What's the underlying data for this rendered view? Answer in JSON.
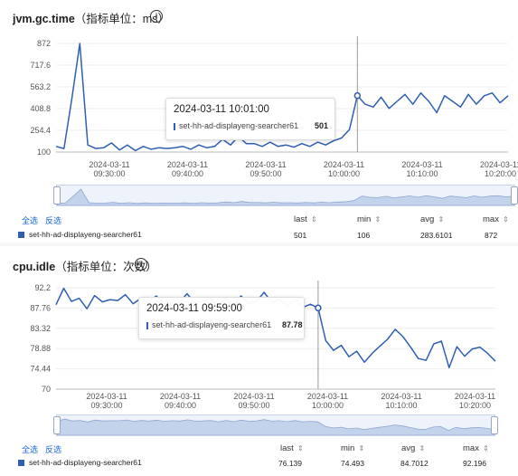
{
  "panels": [
    {
      "title": "jvm.gc.time",
      "unit": "（指标单位：ms）",
      "y_ticks": [
        "872",
        "717.6",
        "563.2",
        "408.8",
        "254.4",
        "100"
      ],
      "x_ticks": [
        [
          "2024-03-11",
          "09:30:00"
        ],
        [
          "2024-03-11",
          "09:40:00"
        ],
        [
          "2024-03-11",
          "09:50:00"
        ],
        [
          "2024-03-11",
          "10:00:00"
        ],
        [
          "2024-03-11",
          "10:10:00"
        ],
        [
          "2024-03-11",
          "10:20:00"
        ]
      ],
      "tooltip": {
        "time": "2024-03-11 10:01:00",
        "series": "set-hh-ad-displayeng-searcher61",
        "value": "501"
      },
      "actions": {
        "select_all": "全选",
        "invert": "反选"
      },
      "stats_headers": {
        "last": "last",
        "min": "min",
        "avg": "avg",
        "max": "max"
      },
      "legend": {
        "name": "set-hh-ad-displayeng-searcher61",
        "last": "501",
        "min": "106",
        "avg": "283.6101",
        "max": "872"
      }
    },
    {
      "title": "cpu.idle",
      "unit": "（指标单位：次数）",
      "y_ticks": [
        "92.2",
        "87.76",
        "83.32",
        "78.88",
        "74.44",
        "70"
      ],
      "x_ticks": [
        [
          "2024-03-11",
          "09:30:00"
        ],
        [
          "2024-03-11",
          "09:40:00"
        ],
        [
          "2024-03-11",
          "09:50:00"
        ],
        [
          "2024-03-11",
          "10:00:00"
        ],
        [
          "2024-03-11",
          "10:10:00"
        ],
        [
          "2024-03-11",
          "10:20:00"
        ]
      ],
      "tooltip": {
        "time": "2024-03-11 09:59:00",
        "series": "set-hh-ad-displayeng-searcher61",
        "value": "87.78"
      },
      "actions": {
        "select_all": "全选",
        "invert": "反选"
      },
      "stats_headers": {
        "last": "last",
        "min": "min",
        "avg": "avg",
        "max": "max"
      },
      "legend": {
        "name": "set-hh-ad-displayeng-searcher61",
        "last": "76.139",
        "min": "74.493",
        "avg": "84.7012",
        "max": "92.196"
      }
    }
  ],
  "chart_data": [
    {
      "type": "line",
      "ylim": [
        100,
        872
      ],
      "x_start": "09:25",
      "x_end": "10:22",
      "series": [
        {
          "name": "set-hh-ad-displayeng-searcher61",
          "color": "#2f5fb3",
          "values": [
            140,
            125,
            480,
            872,
            150,
            125,
            130,
            165,
            115,
            150,
            110,
            140,
            120,
            130,
            125,
            130,
            140,
            120,
            150,
            130,
            140,
            190,
            150,
            210,
            160,
            160,
            140,
            170,
            140,
            150,
            135,
            160,
            140,
            170,
            150,
            180,
            200,
            260,
            501,
            440,
            420,
            490,
            410,
            460,
            510,
            440,
            520,
            460,
            380,
            500,
            460,
            420,
            510,
            440,
            500,
            520,
            450,
            500
          ]
        }
      ]
    },
    {
      "type": "line",
      "ylim": [
        70,
        92.2
      ],
      "x_start": "09:25",
      "x_end": "10:22",
      "series": [
        {
          "name": "set-hh-ad-displayeng-searcher61",
          "color": "#2f5fb3",
          "values": [
            88.5,
            92.1,
            89.2,
            89.9,
            87.6,
            90.5,
            89.1,
            89.6,
            89.4,
            90.7,
            88.7,
            89.9,
            89.0,
            90.4,
            88.8,
            89.5,
            89.0,
            90.9,
            88.9,
            89.2,
            89.9,
            87.9,
            89.9,
            88.2,
            90.4,
            88.8,
            89.2,
            91.2,
            88.9,
            89.6,
            88.0,
            89.8,
            87.9,
            88.6,
            87.78,
            80.6,
            78.5,
            79.6,
            77.1,
            78.3,
            75.9,
            77.8,
            79.4,
            80.9,
            83.1,
            81.5,
            79.2,
            76.7,
            76.3,
            79.9,
            80.5,
            74.7,
            79.3,
            77.2,
            78.8,
            79.2,
            77.8,
            76.1
          ]
        }
      ]
    }
  ]
}
